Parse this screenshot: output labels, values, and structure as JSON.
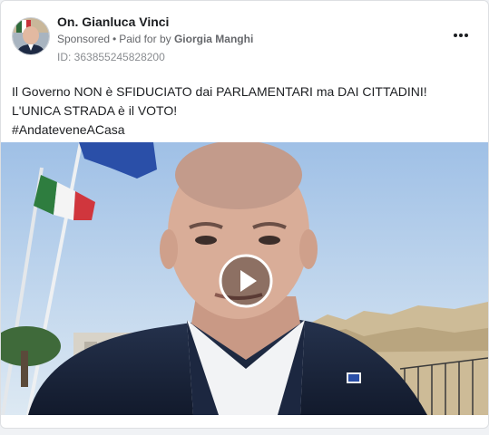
{
  "post": {
    "page_name": "On. Gianluca Vinci",
    "sponsored_label": "Sponsored",
    "separator": "•",
    "paid_for_prefix": "Paid for by",
    "payer": "Giorgia Manghi",
    "ad_id": "ID: 363855245828200",
    "more_icon": "more-horizontal-icon",
    "text_lines": [
      "Il Governo NON è SFIDUCIATO dai PARLAMENTARI ma DAI CITTADINI!",
      "L'UNICA STRADA è il VOTO!",
      "#AndateveneACasa"
    ],
    "media": {
      "kind": "video",
      "play_icon": "play-icon"
    }
  },
  "colors": {
    "card_bg": "#ffffff",
    "page_bg": "#f0f2f5",
    "secondary_text": "#65676b",
    "primary_text": "#1c1e21"
  }
}
